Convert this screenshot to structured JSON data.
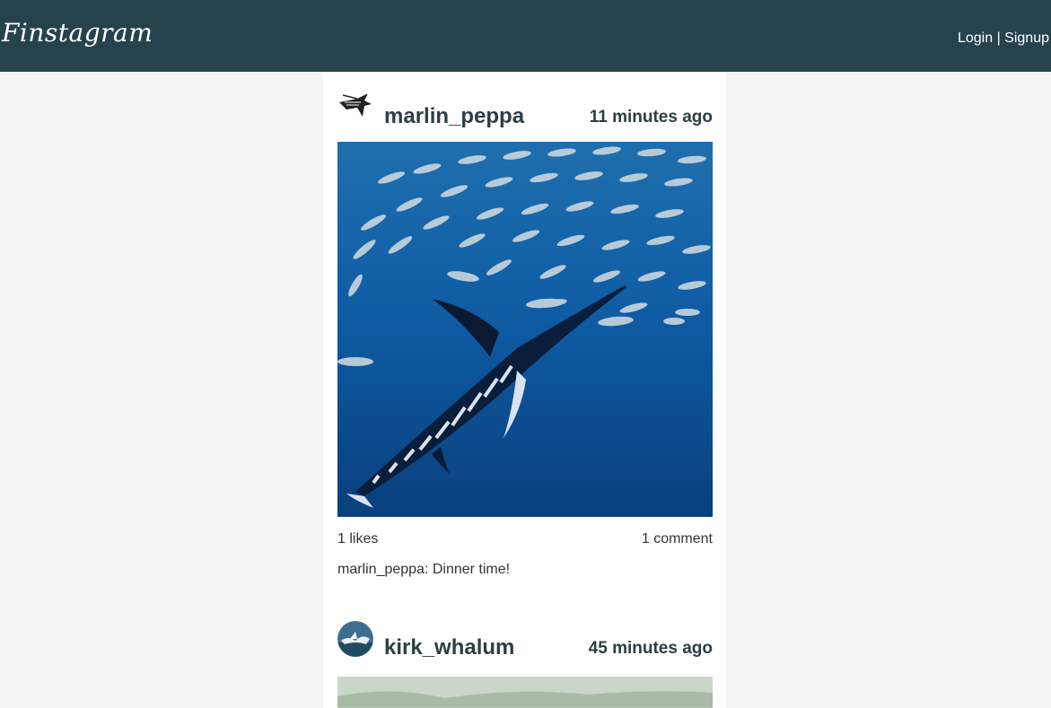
{
  "nav": {
    "brand": "Finstagram",
    "login": "Login",
    "separator": "|",
    "signup": "Signup"
  },
  "posts": [
    {
      "username": "marlin_peppa",
      "time": "11 minutes ago",
      "likes": "1 likes",
      "comments": "1 comment",
      "caption": "marlin_peppa: Dinner time!"
    },
    {
      "username": "kirk_whalum",
      "time": "45 minutes ago"
    }
  ],
  "colors": {
    "navbar": "#26434d",
    "background": "#f4f4f4",
    "text": "#2c3e45"
  }
}
